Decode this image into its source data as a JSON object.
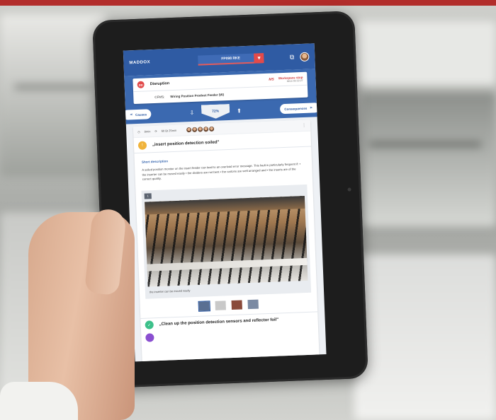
{
  "app": {
    "brand": "MADDOX",
    "order_number": "FP098 RKE",
    "order_flag_icon": "down-arrow-flag-icon",
    "accent_color": "#2f5ba3",
    "alert_color": "#e34a4a"
  },
  "disruption": {
    "badge": "DD",
    "title": "Disruption",
    "logo": "MS",
    "workspace_label": "Workspace stop",
    "workspace_time": "since 02:22:27",
    "cfms_label": "CFMS:",
    "cfms_value": "Wiring Position Product Feeder (W)"
  },
  "nav": {
    "causes_label": "Causes",
    "progress_percent": "72%",
    "consequences_label": "Consequences"
  },
  "meta": {
    "duration": "8min",
    "refresh_text": "60 Bt 25min"
  },
  "cause": {
    "title": "„insert position detection soiled\"",
    "short_description_label": "Short description",
    "short_description": "A soiled position monitor on the insert feeder can lead to an overload error message. This fault is particularly frequent if: • the inserter can be moved easily • the dividers are not bent • the cartons are well arranged and • the inserts are of the correct quality."
  },
  "photo": {
    "number": "1",
    "caption": "the inserter can be moved easily"
  },
  "measure": {
    "title": "„Clean up the position detection sensors and reflector foil\""
  }
}
